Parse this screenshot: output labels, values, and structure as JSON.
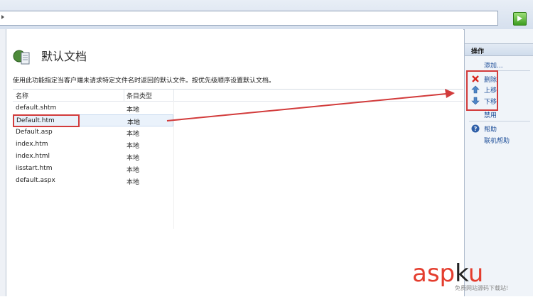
{
  "page": {
    "title": "默认文档",
    "description": "使用此功能指定当客户端未请求特定文件名时返回的默认文件。按优先级顺序设置默认文档。"
  },
  "table": {
    "columns": [
      "名称",
      "条目类型"
    ],
    "rows": [
      {
        "name": "default.shtm",
        "type": "本地"
      },
      {
        "name": "Default.htm",
        "type": "本地"
      },
      {
        "name": "Default.asp",
        "type": "本地"
      },
      {
        "name": "index.htm",
        "type": "本地"
      },
      {
        "name": "index.html",
        "type": "本地"
      },
      {
        "name": "iisstart.htm",
        "type": "本地"
      },
      {
        "name": "default.aspx",
        "type": "本地"
      }
    ],
    "selected_row": "Default.htm"
  },
  "actions": {
    "header": "操作",
    "add": "添加...",
    "delete": "删除",
    "move_up": "上移",
    "move_down": "下移",
    "disable": "禁用",
    "help": "帮助",
    "online_help": "联机帮助"
  },
  "watermark": {
    "asp": "asp",
    "k": "k",
    "u": "u",
    "sub": "免费网站源码下载站!"
  },
  "colors": {
    "highlight_red": "#d23b3b",
    "link_blue": "#1f4f99",
    "go_green": "#3c9c1f"
  }
}
